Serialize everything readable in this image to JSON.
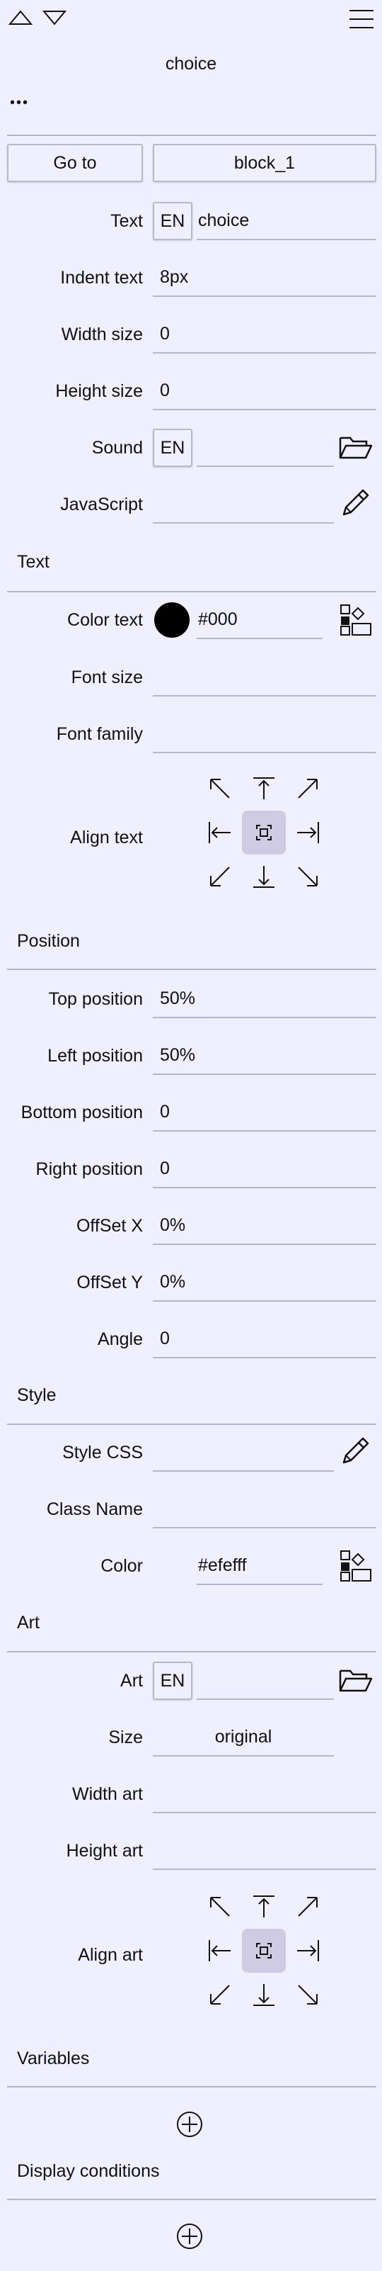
{
  "header": {
    "title": "choice",
    "more": "•••",
    "icons": [
      "triangle-up-icon",
      "triangle-down-icon",
      "hamburger-menu-icon"
    ]
  },
  "goto": {
    "label": "Go to",
    "value": "block_1"
  },
  "fields": {
    "text": {
      "label": "Text",
      "lang": "EN",
      "value": "choice"
    },
    "indent": {
      "label": "Indent text",
      "value": "8px"
    },
    "width": {
      "label": "Width size",
      "value": "0"
    },
    "height": {
      "label": "Height size",
      "value": "0"
    },
    "sound": {
      "label": "Sound",
      "lang": "EN",
      "value": ""
    },
    "javascript": {
      "label": "JavaScript",
      "value": ""
    }
  },
  "text_section": {
    "title": "Text",
    "color_label": "Color text",
    "color_value": "#000",
    "font_size_label": "Font size",
    "font_size_value": "",
    "font_family_label": "Font family",
    "font_family_value": "",
    "align_label": "Align text"
  },
  "position_section": {
    "title": "Position",
    "top_label": "Top position",
    "top_value": "50%",
    "left_label": "Left position",
    "left_value": "50%",
    "bottom_label": "Bottom position",
    "bottom_value": "0",
    "right_label": "Right position",
    "right_value": "0",
    "offx_label": "OffSet X",
    "offx_value": "0%",
    "offy_label": "OffSet Y",
    "offy_value": "0%",
    "angle_label": "Angle",
    "angle_value": "0"
  },
  "style_section": {
    "title": "Style",
    "css_label": "Style CSS",
    "css_value": "",
    "class_label": "Class Name",
    "class_value": "",
    "color_label": "Color",
    "color_value": "#efefff"
  },
  "art_section": {
    "title": "Art",
    "art_label": "Art",
    "art_lang": "EN",
    "art_value": "",
    "size_label": "Size",
    "size_value": "original",
    "width_label": "Width art",
    "width_value": "",
    "height_label": "Height art",
    "height_value": "",
    "align_label": "Align art"
  },
  "variables_section": {
    "title": "Variables"
  },
  "conditions_section": {
    "title": "Display conditions"
  },
  "colors": {
    "background": "#efefff",
    "divider": "#b5b5c3",
    "align_selected": "#cfcbe3"
  }
}
